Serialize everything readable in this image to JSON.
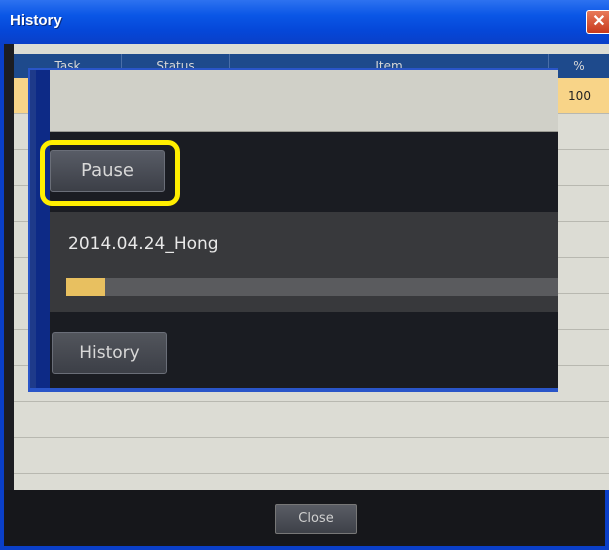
{
  "window": {
    "title": "History",
    "close_glyph": "✕"
  },
  "table": {
    "columns": [
      "Task",
      "Status",
      "Item",
      "%"
    ],
    "rows": [
      {
        "percent": "100",
        "selected": true
      }
    ]
  },
  "overlay": {
    "pause_label": "Pause",
    "task_name": "2014.04.24_Hong",
    "progress": 0.08,
    "history_label": "History"
  },
  "footer": {
    "close_label": "Close"
  },
  "colors": {
    "highlight": "#ffee00",
    "progress_fill": "#e8c060",
    "selected_row": "#f8d488"
  }
}
